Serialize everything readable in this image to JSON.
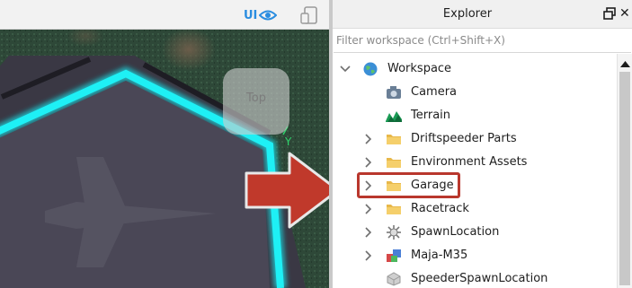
{
  "viewport": {
    "ui_toggle_label": "UI",
    "view_cube_label": "Top",
    "axis_label": "Y"
  },
  "explorer": {
    "title": "Explorer",
    "filter_placeholder": "Filter workspace (Ctrl+Shift+X)",
    "close_glyph": "✕",
    "tree": [
      {
        "label": "Workspace",
        "icon": "globe-icon",
        "expanded": true
      },
      {
        "label": "Camera",
        "icon": "camera-icon"
      },
      {
        "label": "Terrain",
        "icon": "terrain-icon"
      },
      {
        "label": "Driftspeeder Parts",
        "icon": "folder-icon",
        "collapsed": true
      },
      {
        "label": "Environment Assets",
        "icon": "folder-icon",
        "collapsed": true
      },
      {
        "label": "Garage",
        "icon": "folder-icon",
        "collapsed": true,
        "highlighted": true
      },
      {
        "label": "Racetrack",
        "icon": "folder-icon",
        "collapsed": true
      },
      {
        "label": "SpawnLocation",
        "icon": "spawn-icon",
        "collapsed": true
      },
      {
        "label": "Maja-M35",
        "icon": "model-icon",
        "collapsed": true
      },
      {
        "label": "SpeederSpawnLocation",
        "icon": "part-icon"
      }
    ]
  },
  "colors": {
    "highlight": "#b9372d",
    "neon": "#19e8f0",
    "accent": "#2a8de0"
  }
}
